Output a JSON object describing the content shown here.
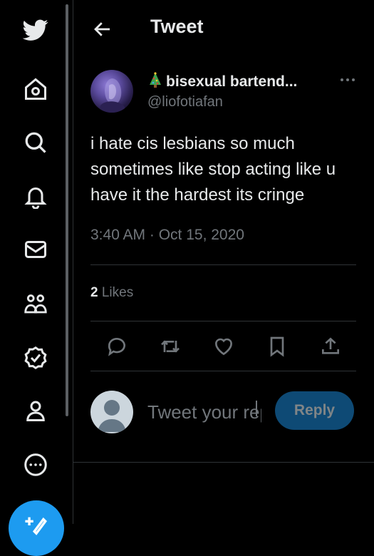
{
  "header": {
    "title": "Tweet"
  },
  "tweet": {
    "display_name": "bisexual bartend...",
    "handle": "@liofotiafan",
    "text": "i hate cis lesbians so much sometimes like stop acting like u have it the hardest its cringe",
    "timestamp": "3:40 AM · Oct 15, 2020",
    "likes_count": "2",
    "likes_label": "Likes"
  },
  "reply": {
    "placeholder": "Tweet your reply",
    "button_label": "Reply"
  },
  "nav": [
    {
      "icon": "twitter-logo-icon"
    },
    {
      "icon": "home-icon"
    },
    {
      "icon": "search-icon"
    },
    {
      "icon": "bell-icon"
    },
    {
      "icon": "mail-icon"
    },
    {
      "icon": "communities-icon"
    },
    {
      "icon": "verified-icon"
    },
    {
      "icon": "profile-icon"
    },
    {
      "icon": "more-circle-icon"
    }
  ],
  "colors": {
    "background": "#000000",
    "text": "#e7e9ea",
    "secondary_text": "#71767b",
    "accent": "#1d9bf0",
    "divider": "#2f3336",
    "reply_button_disabled": "#0e4a75"
  }
}
